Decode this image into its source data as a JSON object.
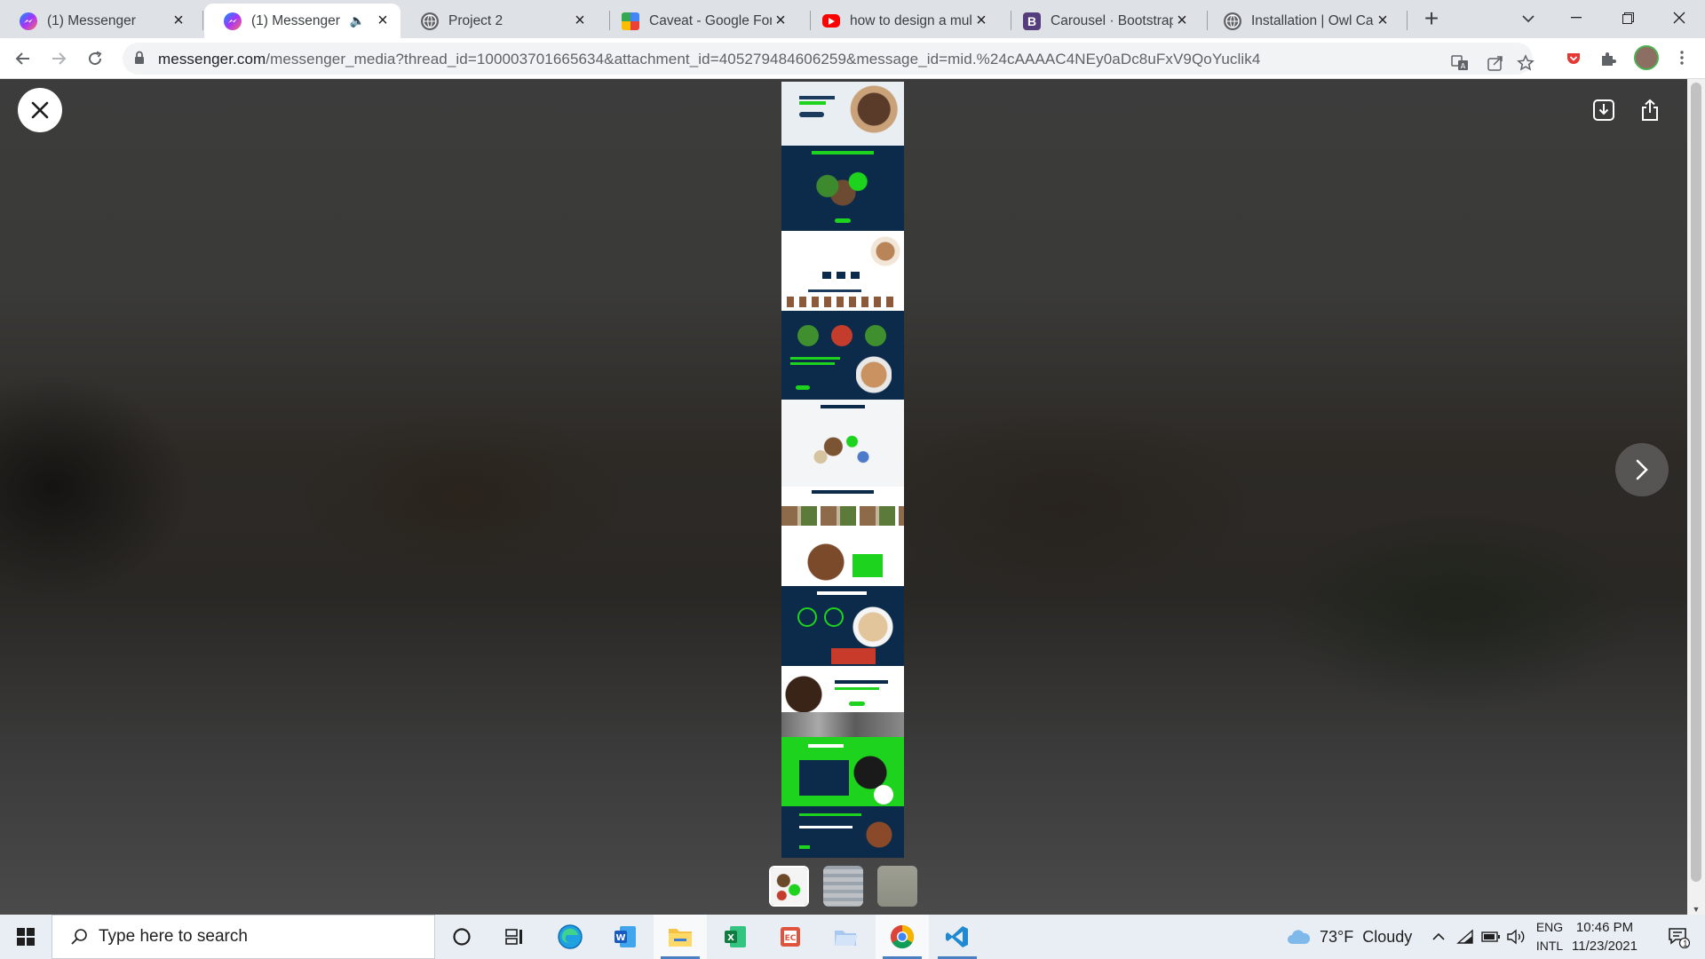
{
  "browser": {
    "tabs": [
      {
        "title": "(1) Messenger",
        "icon": "messenger-icon",
        "active": false
      },
      {
        "title": "(1) Messenger",
        "icon": "messenger-icon",
        "active": true,
        "audio": true
      },
      {
        "title": "Project 2",
        "icon": "globe-icon",
        "active": false
      },
      {
        "title": "Caveat - Google Fonts",
        "icon": "google-fonts-icon",
        "active": false
      },
      {
        "title": "how to design a multi",
        "icon": "youtube-icon",
        "active": false
      },
      {
        "title": "Carousel · Bootstrap",
        "icon": "bootstrap-icon",
        "active": false
      },
      {
        "title": "Installation | Owl Caro",
        "icon": "globe-icon",
        "active": false
      }
    ],
    "address_bar": {
      "host": "messenger.com",
      "path": "/messenger_media?thread_id=100003701665634&attachment_id=405279484606259&message_id=mid.%24cAAAAC4NEy0aDc8uFxV9QoYuclik4"
    },
    "colors": {
      "messenger": "#a445f5",
      "youtube": "#ff0000",
      "bootstrap": "#563d7c",
      "accent_green": "#1ed31e",
      "navy": "#0c2a4a"
    }
  },
  "viewer": {
    "media_count": 3,
    "selected_index": 0
  },
  "taskbar": {
    "search_placeholder": "Type here to search",
    "weather": {
      "temp": "73°F",
      "condition": "Cloudy"
    },
    "language": {
      "line1": "ENG",
      "line2": "INTL"
    },
    "clock": {
      "time": "10:46 PM",
      "date": "11/23/2021"
    },
    "notification_count": "1",
    "apps": [
      "cortana-icon",
      "task-view-icon",
      "edge-icon",
      "word-icon",
      "file-explorer-icon",
      "excel-icon",
      "office-icon",
      "folder-icon",
      "chrome-icon",
      "vscode-icon"
    ]
  }
}
